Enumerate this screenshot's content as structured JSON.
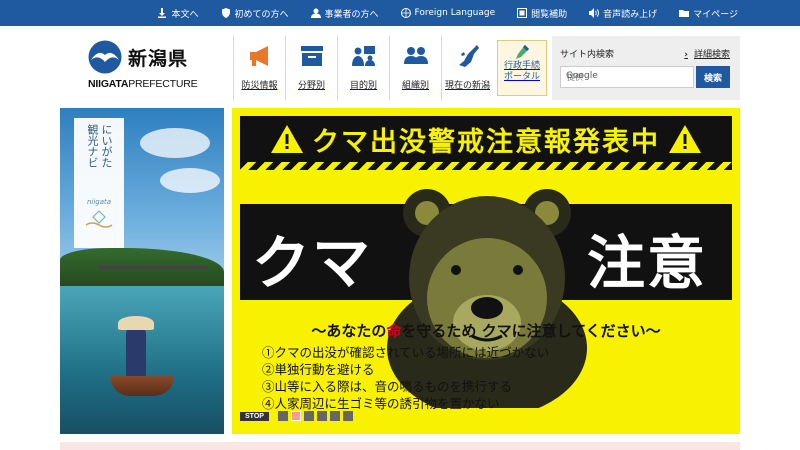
{
  "topbar": {
    "links": [
      {
        "label": "本文へ",
        "icon": "download-icon"
      },
      {
        "label": "初めての方へ",
        "icon": "shield-icon"
      },
      {
        "label": "事業者の方へ",
        "icon": "person-icon"
      },
      {
        "label": "Foreign Language",
        "icon": "globe-icon"
      },
      {
        "label": "閲覧補助",
        "icon": "screen-icon"
      },
      {
        "label": "音声読み上げ",
        "icon": "speaker-icon"
      },
      {
        "label": "マイページ",
        "icon": "folder-icon"
      }
    ]
  },
  "logo": {
    "ja": "新潟県",
    "en_bold": "NIIGATA",
    "en_rest": "PREFECTURE"
  },
  "nav": {
    "items": [
      {
        "label": "防災情報",
        "icon": "megaphone-icon",
        "color": "#e8772a"
      },
      {
        "label": "分野別",
        "icon": "box-icon",
        "color": "#1f5aa0"
      },
      {
        "label": "目的別",
        "icon": "people-board-icon",
        "color": "#1f5aa0"
      },
      {
        "label": "組織別",
        "icon": "group-icon",
        "color": "#1f5aa0"
      },
      {
        "label": "現在の新潟",
        "icon": "map-icon",
        "color": "#1f5aa0"
      }
    ],
    "portal": {
      "line1": "行政手続",
      "line2": "ポータル"
    }
  },
  "search": {
    "title": "サイト内検索",
    "advanced": "詳細検索",
    "provider": "Google",
    "placeholder": "提供",
    "button": "検索"
  },
  "tourism": {
    "vertical1": "にいがた",
    "vertical2": "観光ナビ",
    "sub": "niigata"
  },
  "bear": {
    "headline": "クマ出没警戒注意報発表中",
    "big_left": "クマ",
    "big_right": "注意",
    "sub_prefix": "～あなたの",
    "sub_red": "命",
    "sub_suffix": "を守るため クマに注意してください～",
    "tips": [
      "①クマの出没が確認されている場所には近づかない",
      "②単独行動を避ける",
      "③山等に入る際は、音の鳴るものを携行する",
      "④人家周辺に生ゴミ等の誘引物を置かない"
    ],
    "stop": "STOP",
    "slide_count": 6,
    "active_slide": 1
  },
  "colors": {
    "brand": "#1f5aa0",
    "warning_yellow": "#f8f200",
    "accent_red": "#d0021b"
  }
}
